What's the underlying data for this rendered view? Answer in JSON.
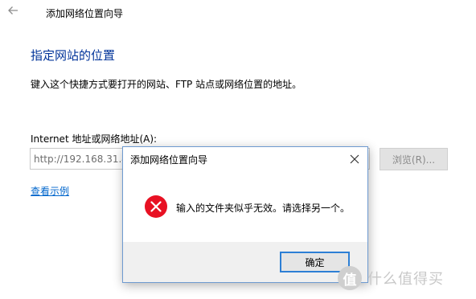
{
  "window": {
    "title": "添加网络位置向导"
  },
  "wizard": {
    "heading": "指定网站的位置",
    "instruction": "键入这个快捷方式要打开的网站、FTP 站点或网络位置的地址。",
    "field_label": "Internet 地址或网络地址(A):",
    "address_value": "http://192.168.31.46",
    "browse_label": "浏览(R)...",
    "example_link": "查看示例"
  },
  "dialog": {
    "title": "添加网络位置向导",
    "message": "输入的文件夹似乎无效。请选择另一个。",
    "ok_label": "确定"
  },
  "watermark": {
    "badge": "值",
    "text": "什么值得买"
  },
  "colors": {
    "heading": "#003399",
    "link": "#0066cc",
    "error_red": "#e81123",
    "focus_blue": "#2d7fd5"
  }
}
